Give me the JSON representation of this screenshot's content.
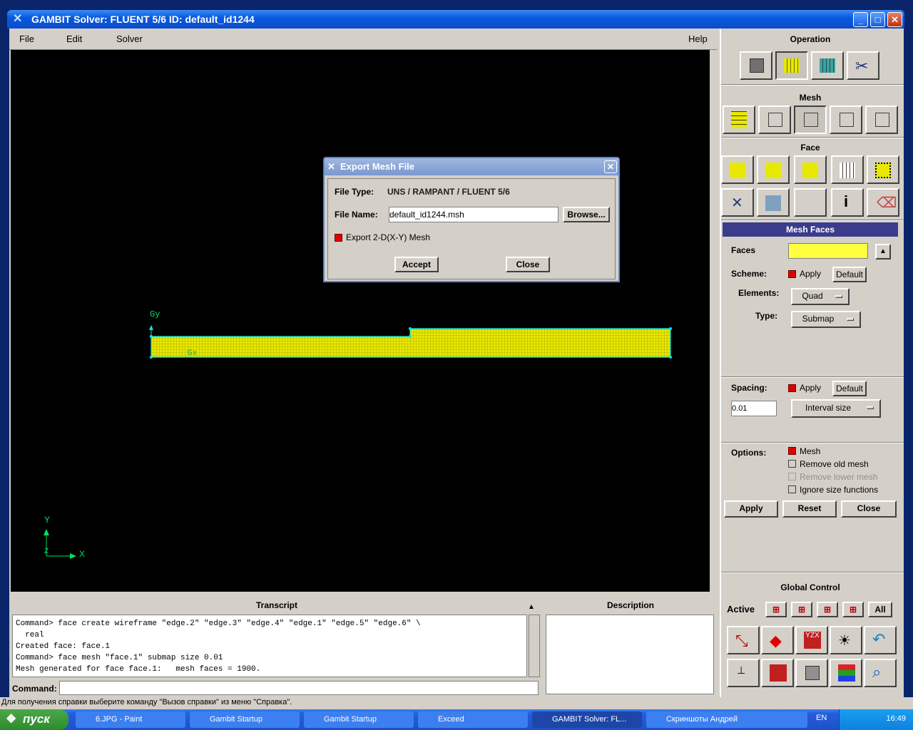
{
  "window": {
    "title": "GAMBIT     Solver: FLUENT 5/6    ID: default_id1244",
    "controls": {
      "minimize": "_",
      "maximize": "□",
      "close": "✕"
    }
  },
  "menubar": {
    "file": "File",
    "edit": "Edit",
    "solver": "Solver",
    "help": "Help"
  },
  "canvas": {
    "label_gy": "Gy",
    "label_gx": "Gx",
    "axis_y": "Y",
    "axis_x": "X",
    "axis_z": "Z"
  },
  "dialog": {
    "title": "Export Mesh File",
    "file_type_label": "File Type:",
    "file_type_value": "UNS / RAMPANT / FLUENT 5/6",
    "file_name_label": "File Name:",
    "file_name_value": "default_id1244.msh",
    "browse": "Browse...",
    "export_2d": "Export 2-D(X-Y) Mesh",
    "accept": "Accept",
    "close": "Close"
  },
  "panel": {
    "operation_title": "Operation",
    "mesh_title": "Mesh",
    "face_title": "Face",
    "form_title": "Mesh Faces",
    "faces_label": "Faces",
    "scheme_label": "Scheme:",
    "apply_label": "Apply",
    "default_label": "Default",
    "elements_label": "Elements:",
    "elements_value": "Quad",
    "type_label": "Type:",
    "type_value": "Submap",
    "spacing_label": "Spacing:",
    "spacing_apply": "Apply",
    "spacing_default": "Default",
    "spacing_value": "0.01",
    "interval_value": "Interval size",
    "options_label": "Options:",
    "opt_mesh": "Mesh",
    "opt_remove_old": "Remove old mesh",
    "opt_remove_lower": "Remove lower mesh",
    "opt_ignore_size": "Ignore size functions",
    "btn_apply": "Apply",
    "btn_reset": "Reset",
    "btn_close": "Close",
    "global_title": "Global Control",
    "active_label": "Active",
    "all_label": "All"
  },
  "transcript": {
    "title": "Transcript",
    "lines": [
      "Command> face create wireframe \"edge.2\" \"edge.3\" \"edge.4\" \"edge.1\" \"edge.5\" \"edge.6\" \\",
      "  real",
      "Created face: face.1",
      "Command> face mesh \"face.1\" submap size 0.01",
      "Mesh generated for face face.1:   mesh faces = 1900."
    ],
    "command_label": "Command:"
  },
  "description": {
    "title": "Description"
  },
  "statusline": "Для получения справки выберите команду \"Вызов справки\" из меню \"Справка\".",
  "taskbar": {
    "start": "пуск",
    "items": [
      "6.JPG - Paint",
      "Gambit Startup",
      "Gambit Startup",
      "Exceed",
      "GAMBIT      Solver: FL...",
      "Скриншоты Андрей"
    ],
    "lang": "EN",
    "clock": "16:49"
  },
  "colors": {
    "mesh_yellow": "#e8e800",
    "mesh_edge": "#00e8e8",
    "form_title_bg": "#3c3c8c",
    "faces_input": "#ffff40"
  }
}
